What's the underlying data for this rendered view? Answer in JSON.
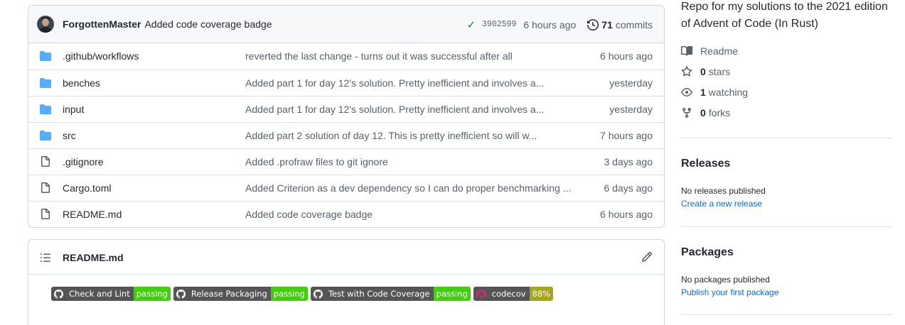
{
  "commit": {
    "author": "ForgottenMaster",
    "message": "Added code coverage badge",
    "sha": "3902599",
    "ago": "6 hours ago",
    "commit_count": "71",
    "commits_label": "commits"
  },
  "files": [
    {
      "name": ".github/workflows",
      "type": "folder",
      "message": "reverted the last change - turns out it was successful after all",
      "age": "6 hours ago"
    },
    {
      "name": "benches",
      "type": "folder",
      "message": "Added part 1 for day 12's solution. Pretty inefficient and involves a...",
      "age": "yesterday"
    },
    {
      "name": "input",
      "type": "folder",
      "message": "Added part 1 for day 12's solution. Pretty inefficient and involves a...",
      "age": "yesterday"
    },
    {
      "name": "src",
      "type": "folder",
      "message": "Added part 2 solution of day 12. This is pretty inefficient so will w...",
      "age": "7 hours ago"
    },
    {
      "name": ".gitignore",
      "type": "file",
      "message": "Added .profraw files to git ignore",
      "age": "3 days ago"
    },
    {
      "name": "Cargo.toml",
      "type": "file",
      "message": "Added Criterion as a dev dependency so I can do proper benchmarking ...",
      "age": "6 days ago"
    },
    {
      "name": "README.md",
      "type": "file",
      "message": "Added code coverage badge",
      "age": "6 hours ago"
    }
  ],
  "readme": {
    "title": "README.md",
    "badges": [
      {
        "label": "Check and Lint",
        "status": "passing",
        "icon": "github-icon"
      },
      {
        "label": "Release Packaging",
        "status": "passing",
        "icon": "github-icon"
      },
      {
        "label": "Test with Code Coverage",
        "status": "passing",
        "icon": "github-icon"
      },
      {
        "label": "codecov",
        "status": "88%",
        "icon": "codecov-icon"
      }
    ]
  },
  "sidebar": {
    "about": "Repo for my solutions to the 2021 edition of Advent of Code (In Rust)",
    "readme_label": "Readme",
    "stars_count": "0",
    "stars_label": "stars",
    "watching_count": "1",
    "watching_label": "watching",
    "forks_count": "0",
    "forks_label": "forks",
    "releases_title": "Releases",
    "releases_note": "No releases published",
    "releases_link": "Create a new release",
    "packages_title": "Packages",
    "packages_note": "No packages published",
    "packages_link": "Publish your first package"
  },
  "colors": {
    "folder": "#54aeff",
    "link": "#0969da",
    "badge_pass": "#44cc11",
    "badge_cov": "#a4a61d",
    "check": "#1a7f37"
  }
}
